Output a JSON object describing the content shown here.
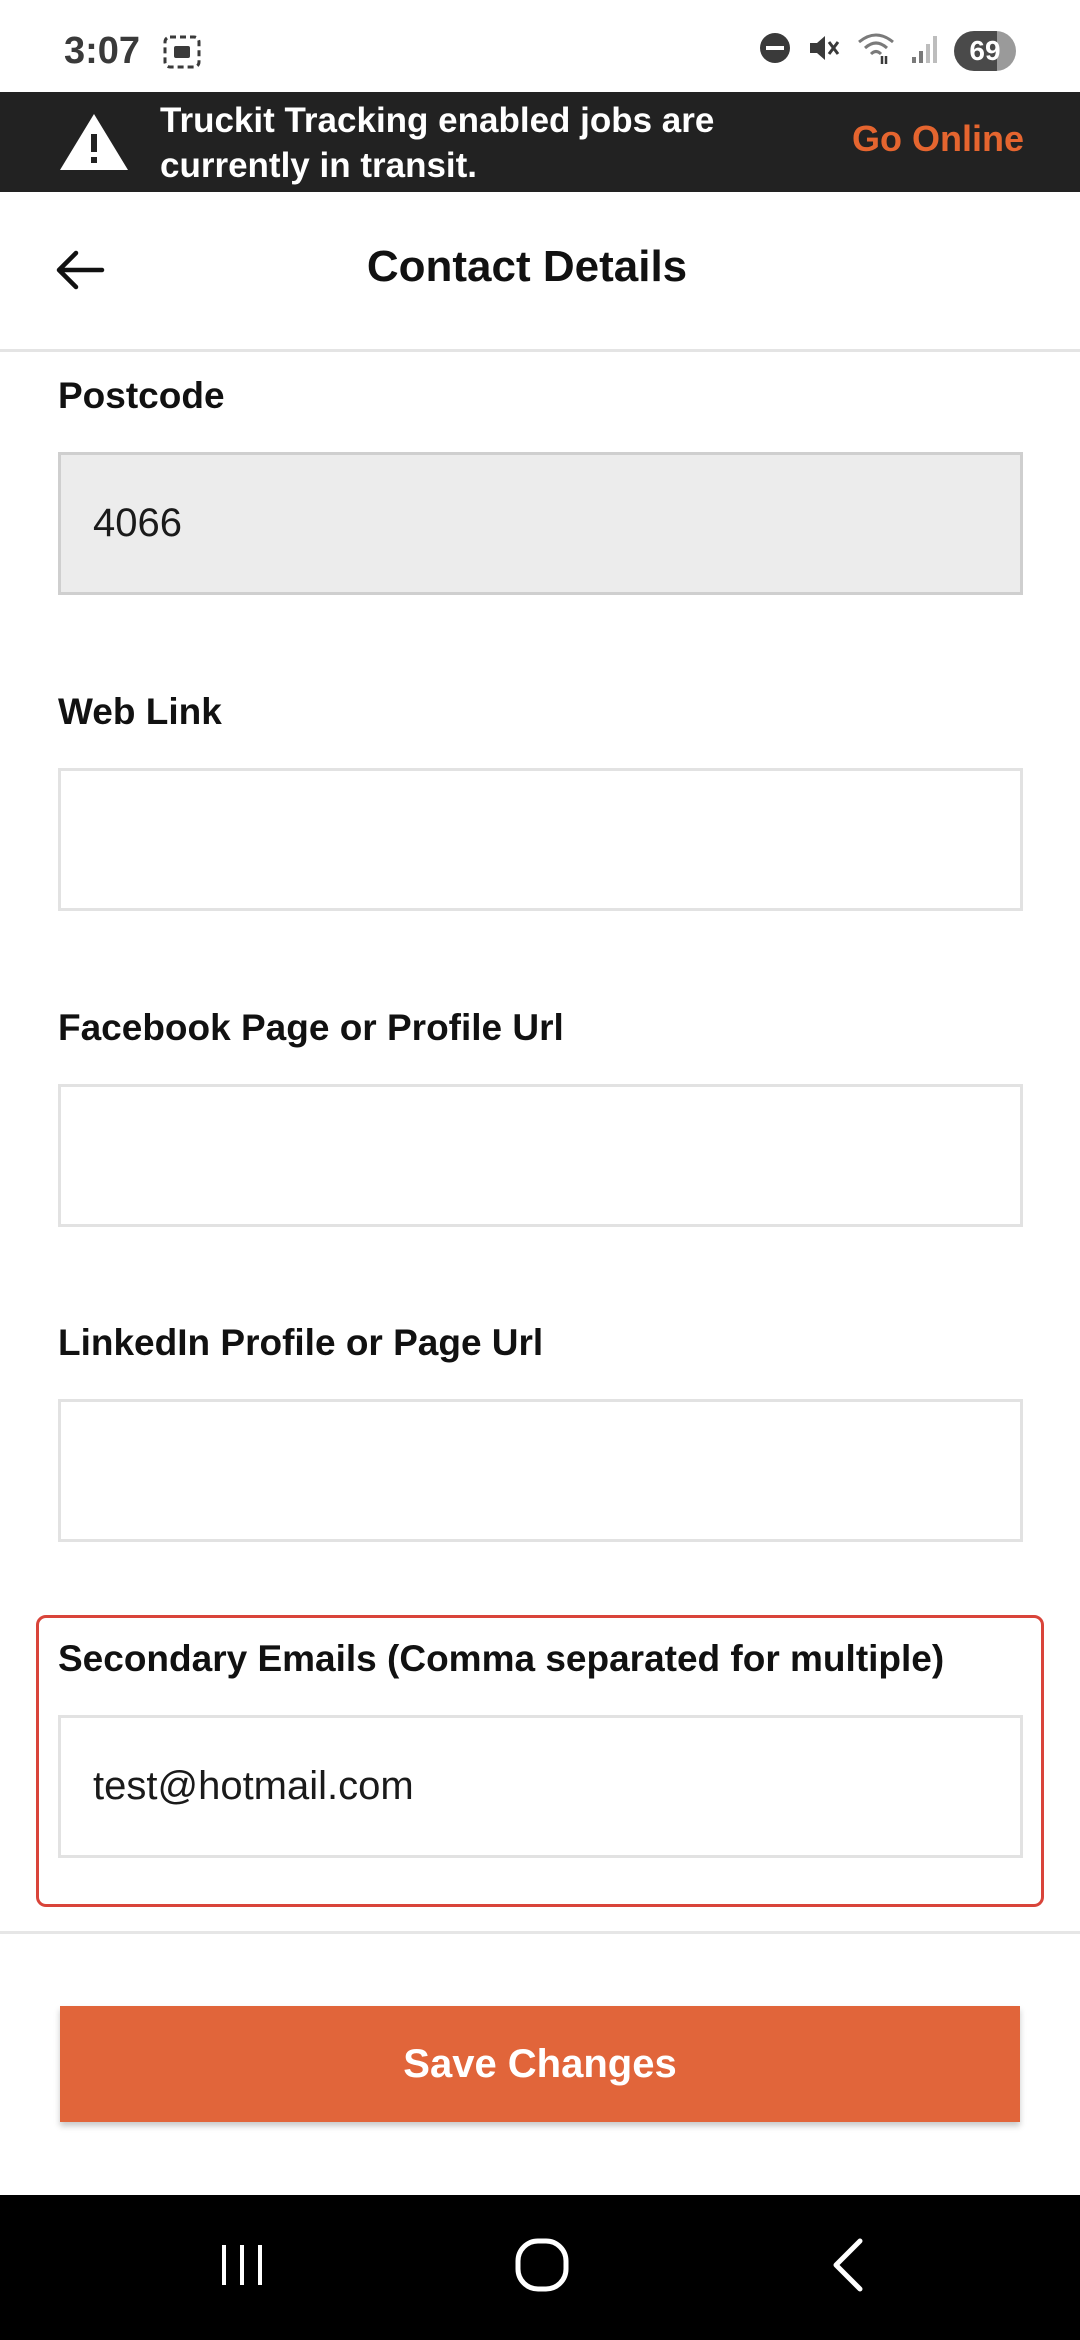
{
  "status_bar": {
    "time": "3:07",
    "battery": "69",
    "icons": [
      "screenshot-icon",
      "dnd-icon",
      "mute-icon",
      "wifi-icon",
      "signal-icon"
    ]
  },
  "banner": {
    "message": "Truckit Tracking enabled jobs are currently in transit.",
    "action_label": "Go Online",
    "accent_color": "#e5652f"
  },
  "header": {
    "title": "Contact Details"
  },
  "form": {
    "postcode": {
      "label": "Postcode",
      "value": "4066"
    },
    "web_link": {
      "label": "Web Link",
      "value": ""
    },
    "facebook": {
      "label": "Facebook Page or Profile Url",
      "value": ""
    },
    "linkedin": {
      "label": "LinkedIn Profile or Page Url",
      "value": ""
    },
    "secondary_emails": {
      "label": "Secondary Emails (Comma separated for multiple)",
      "value": "test@hotmail.com"
    }
  },
  "footer": {
    "save_label": "Save Changes",
    "button_color": "#e1653a"
  },
  "nav_bar": {
    "items": [
      "recent-apps-icon",
      "home-icon",
      "back-icon"
    ]
  }
}
